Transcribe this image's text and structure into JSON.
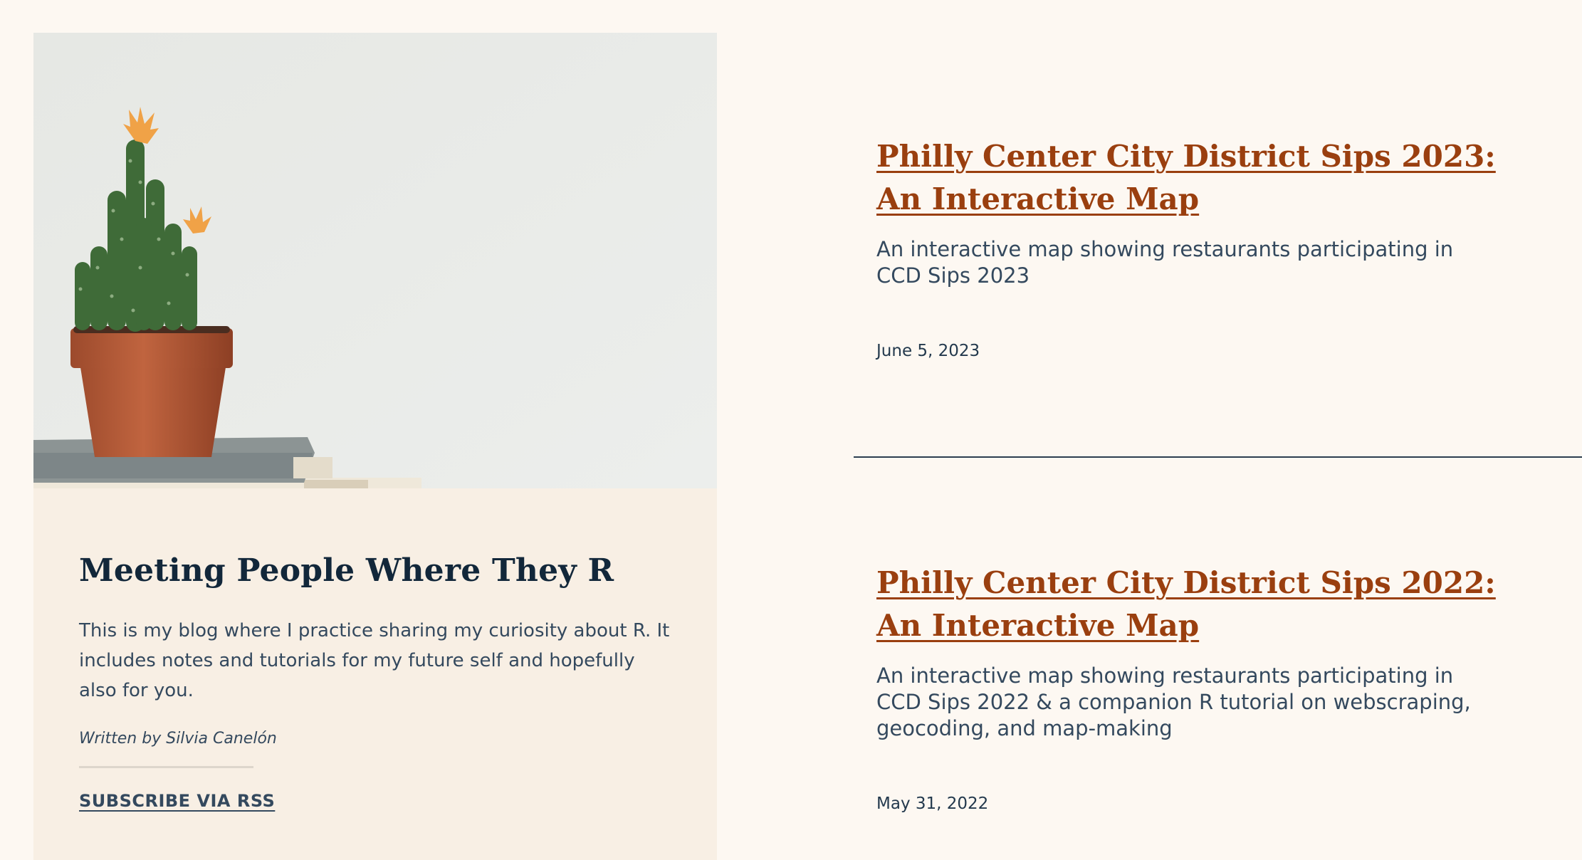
{
  "sidebar": {
    "hero_image_alt": "Potted cactus with orange flowers on a stack of books",
    "title": "Meeting People Where They R",
    "description": "This is my blog where I practice sharing my curiosity about R. It includes notes and tutorials for my future self and hopefully also for you.",
    "byline": "Written by Silvia Canelón",
    "subscribe_label": "SUBSCRIBE VIA RSS"
  },
  "posts": [
    {
      "title": "Philly Center City District Sips 2023: An Interactive Map",
      "description": "An interactive map showing restaurants participating in CCD Sips 2023",
      "date": "June 5, 2023"
    },
    {
      "title": "Philly Center City District Sips 2022: An Interactive Map",
      "description": "An interactive map showing restaurants participating in CCD Sips 2022 & a companion R tutorial on webscraping, geocoding, and map-making",
      "date": "May 31, 2022"
    }
  ],
  "colors": {
    "page_background": "#fdf8f2",
    "sidebar_background": "#f8efe4",
    "link_accent": "#9a3f0f",
    "text": "#34495e",
    "heading": "#12273a"
  }
}
